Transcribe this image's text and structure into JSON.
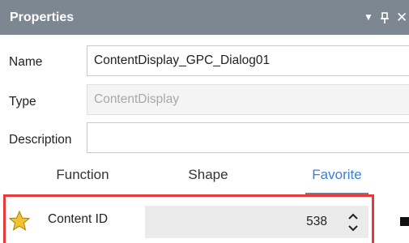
{
  "panel": {
    "title": "Properties"
  },
  "icons": {
    "dropdown": "dropdown-triangle-icon",
    "pin": "pin-icon",
    "close": "close-icon",
    "star": "star-icon",
    "spin_up": "chevron-up-icon",
    "spin_down": "chevron-down-icon"
  },
  "properties": {
    "name_label": "Name",
    "name_value": "ContentDisplay_GPC_Dialog01",
    "type_label": "Type",
    "type_value": "ContentDisplay",
    "description_label": "Description",
    "description_value": ""
  },
  "tabs": [
    {
      "label": "Function"
    },
    {
      "label": "Shape"
    },
    {
      "label": "Favorite"
    }
  ],
  "active_tab": "Favorite",
  "favorite": {
    "content_id_label": "Content ID",
    "content_id_value": "538"
  },
  "colors": {
    "titlebar": "#7d8792",
    "active_tab": "#3f7fd1",
    "highlight": "#e8393c",
    "star": "#f2c230"
  }
}
